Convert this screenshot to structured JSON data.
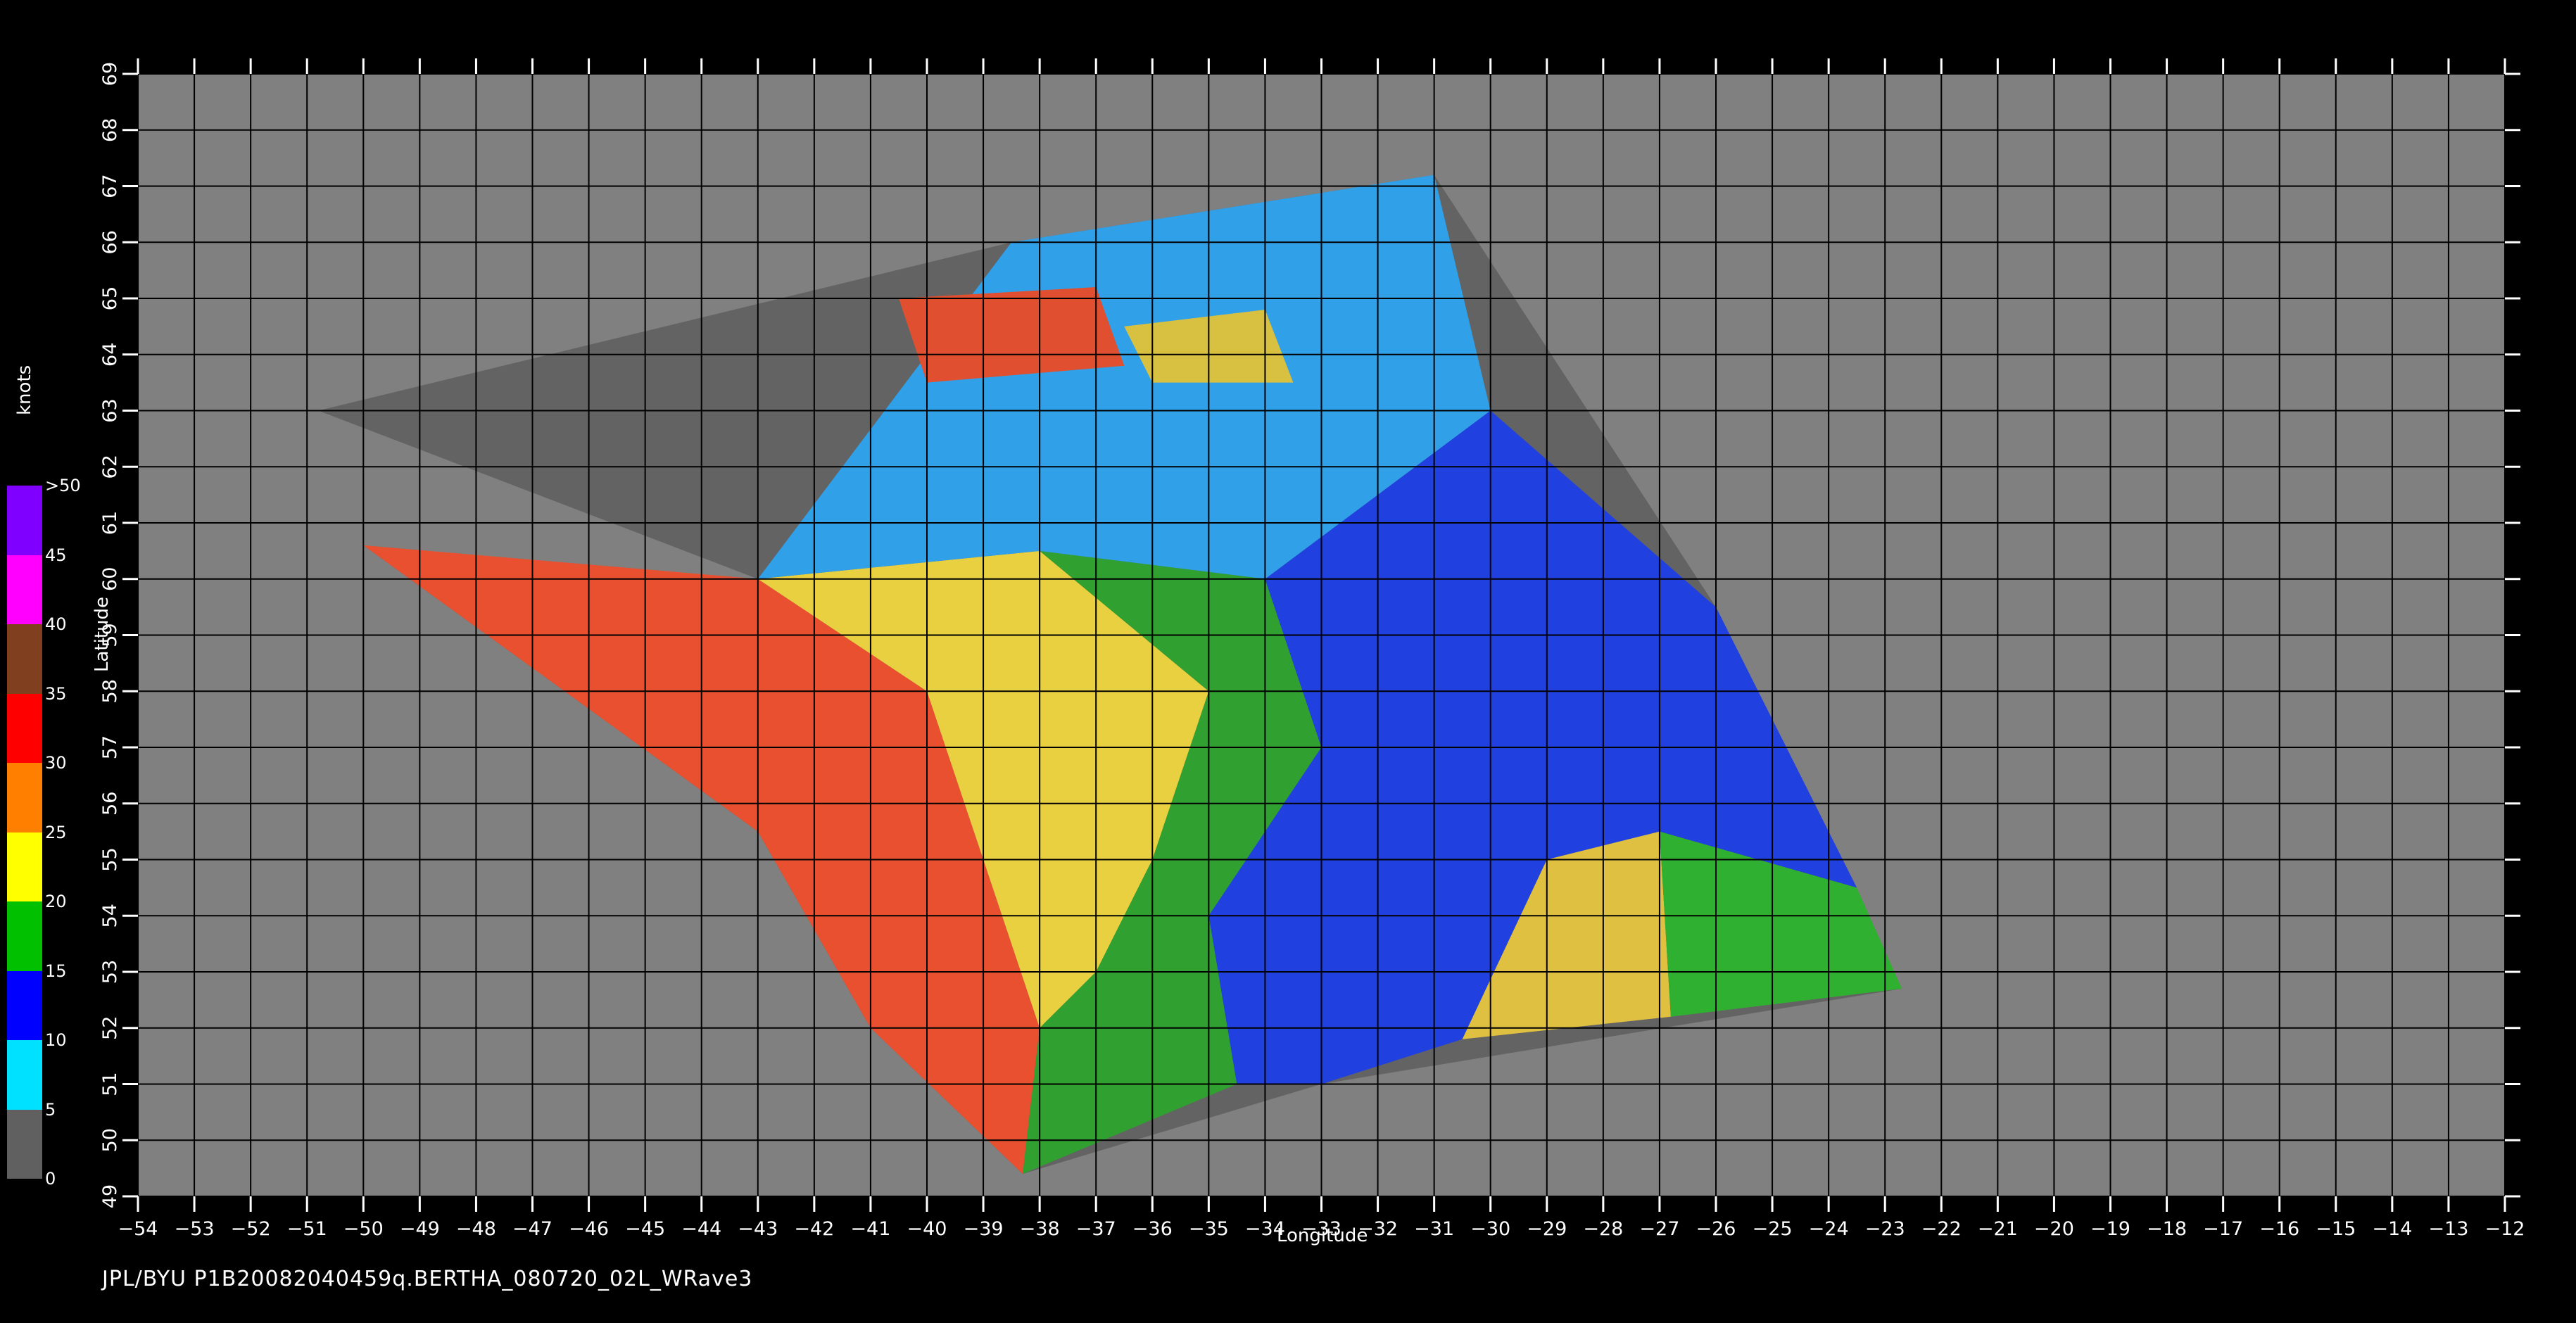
{
  "map": {
    "lon_min": -54,
    "lon_max": -12,
    "lat_min": 49,
    "lat_max": 69,
    "lon_ticks": [
      -54,
      -53,
      -52,
      -51,
      -50,
      -49,
      -48,
      -47,
      -46,
      -45,
      -44,
      -43,
      -42,
      -41,
      -40,
      -39,
      -38,
      -37,
      -36,
      -35,
      -34,
      -33,
      -32,
      -31,
      -30,
      -29,
      -28,
      -27,
      -26,
      -25,
      -24,
      -23,
      -22,
      -21,
      -20,
      -19,
      -18,
      -17,
      -16,
      -15,
      -14,
      -13,
      -12
    ],
    "lat_ticks": [
      49,
      50,
      51,
      52,
      53,
      54,
      55,
      56,
      57,
      58,
      59,
      60,
      61,
      62,
      63,
      64,
      65,
      66,
      67,
      68,
      69
    ],
    "xlabel": "Longitude",
    "ylabel": "Latitude",
    "background_color": "#808080",
    "grid_color": "#000000"
  },
  "colorbar": {
    "units": "knots",
    "tick_labels": [
      ">50",
      "45",
      "40",
      "35",
      "30",
      "25",
      "20",
      "15",
      "10",
      "5",
      "0"
    ],
    "colors": [
      "#606060",
      "#00e0ff",
      "#0000ff",
      "#00c000",
      "#ffff00",
      "#ff8000",
      "#ff0000",
      "#804020",
      "#ff00ff",
      "#8000ff",
      "#ffffff"
    ]
  },
  "swath": {
    "outline_lonlat": [
      [
        -50.8,
        63.0
      ],
      [
        -38.5,
        66.0
      ],
      [
        -31.0,
        67.2
      ],
      [
        -26.0,
        59.5
      ],
      [
        -22.7,
        52.7
      ],
      [
        -33.0,
        51.0
      ],
      [
        -38.3,
        49.4
      ],
      [
        -41.0,
        52.0
      ],
      [
        -43.0,
        55.5
      ],
      [
        -50.0,
        60.6
      ],
      [
        -47.0,
        59.5
      ],
      [
        -45.0,
        60.0
      ],
      [
        -43.0,
        60.0
      ]
    ],
    "wind_regions": [
      {
        "name": "high-wind-west",
        "speed_knots": 28,
        "color": "#e85030",
        "lonlat": [
          [
            -50.0,
            60.6
          ],
          [
            -43.0,
            60.0
          ],
          [
            -40.0,
            58.0
          ],
          [
            -39.0,
            55.0
          ],
          [
            -38.0,
            52.0
          ],
          [
            -38.3,
            49.4
          ],
          [
            -41.0,
            52.0
          ],
          [
            -43.0,
            55.5
          ]
        ]
      },
      {
        "name": "moderate-wind-yellow",
        "speed_knots": 22,
        "color": "#e8d040",
        "lonlat": [
          [
            -43.0,
            60.0
          ],
          [
            -38.0,
            60.5
          ],
          [
            -35.0,
            58.0
          ],
          [
            -36.0,
            55.0
          ],
          [
            -37.0,
            53.0
          ],
          [
            -38.0,
            52.0
          ],
          [
            -39.0,
            55.0
          ],
          [
            -40.0,
            58.0
          ]
        ]
      },
      {
        "name": "moderate-wind-green",
        "speed_knots": 18,
        "color": "#30a030",
        "lonlat": [
          [
            -38.0,
            60.5
          ],
          [
            -34.0,
            60.0
          ],
          [
            -33.0,
            57.0
          ],
          [
            -35.0,
            54.0
          ],
          [
            -34.5,
            51.0
          ],
          [
            -38.3,
            49.4
          ],
          [
            -38.0,
            52.0
          ],
          [
            -37.0,
            53.0
          ],
          [
            -36.0,
            55.0
          ],
          [
            -35.0,
            58.0
          ]
        ]
      },
      {
        "name": "low-wind-blue",
        "speed_knots": 12,
        "color": "#2040e0",
        "lonlat": [
          [
            -34.0,
            60.0
          ],
          [
            -30.0,
            63.0
          ],
          [
            -26.0,
            59.5
          ],
          [
            -23.5,
            54.5
          ],
          [
            -27.0,
            55.5
          ],
          [
            -29.0,
            55.0
          ],
          [
            -30.5,
            51.8
          ],
          [
            -33.0,
            51.0
          ],
          [
            -34.5,
            51.0
          ],
          [
            -35.0,
            54.0
          ],
          [
            -33.0,
            57.0
          ]
        ]
      },
      {
        "name": "low-wind-north",
        "speed_knots": 10,
        "color": "#30a0e8",
        "lonlat": [
          [
            -43.0,
            60.0
          ],
          [
            -38.5,
            66.0
          ],
          [
            -31.0,
            67.2
          ],
          [
            -30.0,
            63.0
          ],
          [
            -34.0,
            60.0
          ],
          [
            -38.0,
            60.5
          ]
        ]
      },
      {
        "name": "band-yellow-east",
        "speed_knots": 24,
        "color": "#e0c040",
        "lonlat": [
          [
            -29.0,
            55.0
          ],
          [
            -27.0,
            55.5
          ],
          [
            -26.8,
            52.2
          ],
          [
            -30.5,
            51.8
          ]
        ]
      },
      {
        "name": "band-green-east",
        "speed_knots": 17,
        "color": "#30b030",
        "lonlat": [
          [
            -27.0,
            55.5
          ],
          [
            -23.5,
            54.5
          ],
          [
            -22.7,
            52.7
          ],
          [
            -26.8,
            52.2
          ]
        ]
      },
      {
        "name": "north-red",
        "speed_knots": 30,
        "color": "#e05030",
        "lonlat": [
          [
            -40.5,
            65.0
          ],
          [
            -37.0,
            65.2
          ],
          [
            -36.5,
            63.8
          ],
          [
            -40.0,
            63.5
          ]
        ]
      },
      {
        "name": "north-yellow",
        "speed_knots": 22,
        "color": "#d8c040",
        "lonlat": [
          [
            -36.5,
            64.5
          ],
          [
            -34.0,
            64.8
          ],
          [
            -33.5,
            63.5
          ],
          [
            -36.0,
            63.5
          ]
        ]
      }
    ]
  },
  "caption": "JPL/BYU  P1B20082040459q.BERTHA_080720_02L_WRave3"
}
